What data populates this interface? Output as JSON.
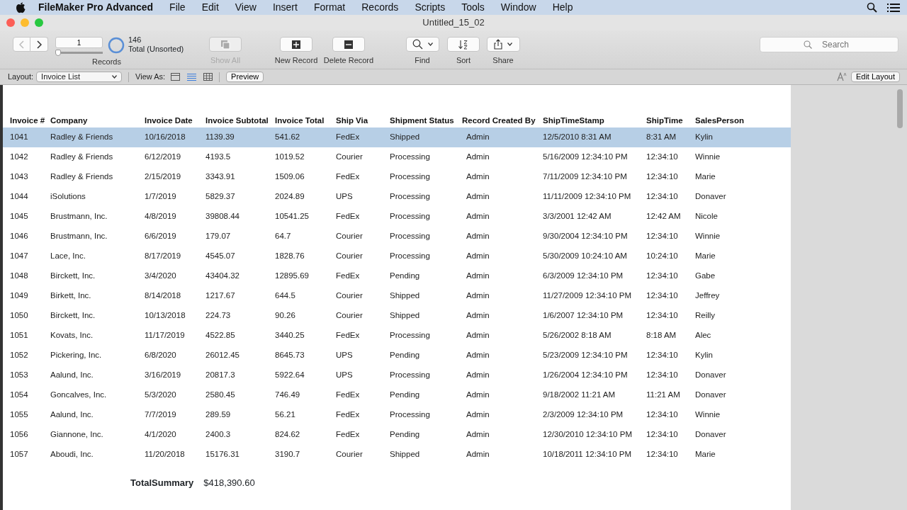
{
  "menu_bar": {
    "app_name": "FileMaker Pro Advanced",
    "items": [
      "File",
      "Edit",
      "View",
      "Insert",
      "Format",
      "Records",
      "Scripts",
      "Tools",
      "Window",
      "Help"
    ]
  },
  "window": {
    "title": "Untitled_15_02"
  },
  "toolbar": {
    "record_number": "1",
    "record_slider": {
      "level": 0
    },
    "found_count": "146",
    "found_status": "Total (Unsorted)",
    "records_label": "Records",
    "buttons": [
      {
        "kind": "show_all",
        "label": "Show All",
        "disabled": true
      },
      {
        "kind": "new_record",
        "label": "New Record",
        "disabled": false
      },
      {
        "kind": "delete_record",
        "label": "Delete Record",
        "disabled": false
      },
      {
        "kind": "find",
        "label": "Find",
        "disabled": false
      },
      {
        "kind": "sort",
        "label": "Sort",
        "disabled": false
      },
      {
        "kind": "share",
        "label": "Share",
        "disabled": false
      }
    ],
    "search": {
      "placeholder": "Search"
    }
  },
  "layout_bar": {
    "layout_label": "Layout:",
    "layout_value": "Invoice List",
    "view_as_label": "View As:",
    "view_modes": [
      {
        "kind": "form",
        "selected": false
      },
      {
        "kind": "list",
        "selected": true
      },
      {
        "kind": "table",
        "selected": false
      }
    ],
    "preview_button": "Preview",
    "edit_layout_button": "Edit Layout"
  },
  "table": {
    "columns": [
      "Invoice #",
      "Company",
      "Invoice Date",
      "Invoice Subtotal",
      "Invoice Total",
      "Ship Via",
      "Shipment Status",
      "Record Created By",
      "ShipTimeStamp",
      "ShipTime",
      "SalesPerson"
    ],
    "rows": [
      {
        "selected": true,
        "cells": [
          "1041",
          "Radley & Friends",
          "10/16/2018",
          "1139.39",
          "541.62",
          "FedEx",
          "Shipped",
          "Admin",
          "12/5/2010 8:31 AM",
          "8:31 AM",
          "Kylin"
        ]
      },
      {
        "selected": false,
        "cells": [
          "1042",
          "Radley & Friends",
          "6/12/2019",
          "4193.5",
          "1019.52",
          "Courier",
          "Processing",
          "Admin",
          "5/16/2009 12:34:10 PM",
          "12:34:10",
          "Winnie"
        ]
      },
      {
        "selected": false,
        "cells": [
          "1043",
          "Radley & Friends",
          "2/15/2019",
          "3343.91",
          "1509.06",
          "FedEx",
          "Processing",
          "Admin",
          "7/11/2009 12:34:10 PM",
          "12:34:10",
          "Marie"
        ]
      },
      {
        "selected": false,
        "cells": [
          "1044",
          "iSolutions",
          "1/7/2019",
          "5829.37",
          "2024.89",
          "UPS",
          "Processing",
          "Admin",
          "11/11/2009 12:34:10 PM",
          "12:34:10",
          "Donaver"
        ]
      },
      {
        "selected": false,
        "cells": [
          "1045",
          "Brustmann, Inc.",
          "4/8/2019",
          "39808.44",
          "10541.25",
          "FedEx",
          "Processing",
          "Admin",
          "3/3/2001 12:42 AM",
          "12:42 AM",
          "Nicole"
        ]
      },
      {
        "selected": false,
        "cells": [
          "1046",
          "Brustmann, Inc.",
          "6/6/2019",
          "179.07",
          "64.7",
          "Courier",
          "Processing",
          "Admin",
          "9/30/2004 12:34:10 PM",
          "12:34:10",
          "Winnie"
        ]
      },
      {
        "selected": false,
        "cells": [
          "1047",
          "Lace, Inc.",
          "8/17/2019",
          "4545.07",
          "1828.76",
          "Courier",
          "Processing",
          "Admin",
          "5/30/2009 10:24:10 AM",
          "10:24:10",
          "Marie"
        ]
      },
      {
        "selected": false,
        "cells": [
          "1048",
          "Birckett, Inc.",
          "3/4/2020",
          "43404.32",
          "12895.69",
          "FedEx",
          "Pending",
          "Admin",
          "6/3/2009 12:34:10 PM",
          "12:34:10",
          "Gabe"
        ]
      },
      {
        "selected": false,
        "cells": [
          "1049",
          "Birkett, Inc.",
          "8/14/2018",
          "1217.67",
          "644.5",
          "Courier",
          "Shipped",
          "Admin",
          "11/27/2009 12:34:10 PM",
          "12:34:10",
          "Jeffrey"
        ]
      },
      {
        "selected": false,
        "cells": [
          "1050",
          "Birckett, Inc.",
          "10/13/2018",
          "224.73",
          "90.26",
          "Courier",
          "Shipped",
          "Admin",
          "1/6/2007 12:34:10 PM",
          "12:34:10",
          "Reilly"
        ]
      },
      {
        "selected": false,
        "cells": [
          "1051",
          "Kovats, Inc.",
          "11/17/2019",
          "4522.85",
          "3440.25",
          "FedEx",
          "Processing",
          "Admin",
          "5/26/2002 8:18 AM",
          "8:18 AM",
          "Alec"
        ]
      },
      {
        "selected": false,
        "cells": [
          "1052",
          "Pickering, Inc.",
          "6/8/2020",
          "26012.45",
          "8645.73",
          "UPS",
          "Pending",
          "Admin",
          "5/23/2009 12:34:10 PM",
          "12:34:10",
          "Kylin"
        ]
      },
      {
        "selected": false,
        "cells": [
          "1053",
          "Aalund, Inc.",
          "3/16/2019",
          "20817.3",
          "5922.64",
          "UPS",
          "Processing",
          "Admin",
          "1/26/2004 12:34:10 PM",
          "12:34:10",
          "Donaver"
        ]
      },
      {
        "selected": false,
        "cells": [
          "1054",
          "Goncalves, Inc.",
          "5/3/2020",
          "2580.45",
          "746.49",
          "FedEx",
          "Pending",
          "Admin",
          "9/18/2002 11:21 AM",
          "11:21 AM",
          "Donaver"
        ]
      },
      {
        "selected": false,
        "cells": [
          "1055",
          "Aalund, Inc.",
          "7/7/2019",
          "289.59",
          "56.21",
          "FedEx",
          "Processing",
          "Admin",
          "2/3/2009 12:34:10 PM",
          "12:34:10",
          "Winnie"
        ]
      },
      {
        "selected": false,
        "cells": [
          "1056",
          "Giannone, Inc.",
          "4/1/2020",
          "2400.3",
          "824.62",
          "FedEx",
          "Pending",
          "Admin",
          "12/30/2010 12:34:10 PM",
          "12:34:10",
          "Donaver"
        ]
      },
      {
        "selected": false,
        "cells": [
          "1057",
          "Aboudi, Inc.",
          "11/20/2018",
          "15176.31",
          "3190.7",
          "Courier",
          "Shipped",
          "Admin",
          "10/18/2011 12:34:10 PM",
          "12:34:10",
          "Marie"
        ]
      }
    ]
  },
  "summary": {
    "label": "TotalSummary",
    "value": "$418,390.60"
  }
}
